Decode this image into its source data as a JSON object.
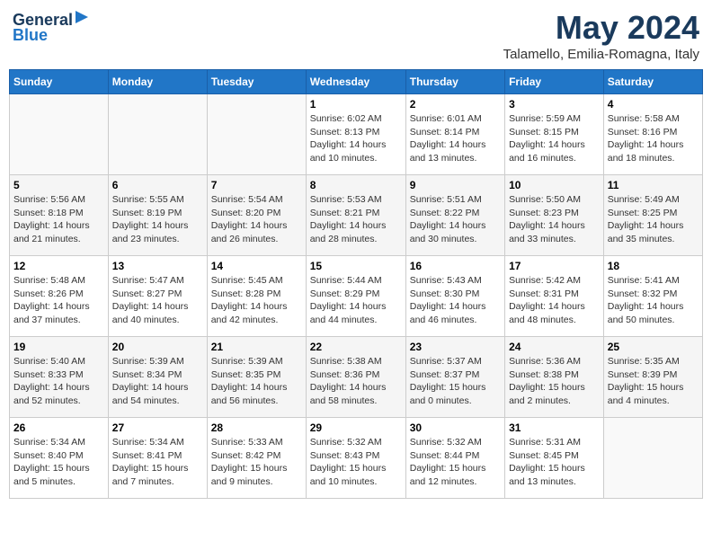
{
  "header": {
    "logo_line1": "General",
    "logo_line2": "Blue",
    "month": "May 2024",
    "location": "Talamello, Emilia-Romagna, Italy"
  },
  "weekdays": [
    "Sunday",
    "Monday",
    "Tuesday",
    "Wednesday",
    "Thursday",
    "Friday",
    "Saturday"
  ],
  "weeks": [
    [
      {
        "day": "",
        "info": ""
      },
      {
        "day": "",
        "info": ""
      },
      {
        "day": "",
        "info": ""
      },
      {
        "day": "1",
        "info": "Sunrise: 6:02 AM\nSunset: 8:13 PM\nDaylight: 14 hours\nand 10 minutes."
      },
      {
        "day": "2",
        "info": "Sunrise: 6:01 AM\nSunset: 8:14 PM\nDaylight: 14 hours\nand 13 minutes."
      },
      {
        "day": "3",
        "info": "Sunrise: 5:59 AM\nSunset: 8:15 PM\nDaylight: 14 hours\nand 16 minutes."
      },
      {
        "day": "4",
        "info": "Sunrise: 5:58 AM\nSunset: 8:16 PM\nDaylight: 14 hours\nand 18 minutes."
      }
    ],
    [
      {
        "day": "5",
        "info": "Sunrise: 5:56 AM\nSunset: 8:18 PM\nDaylight: 14 hours\nand 21 minutes."
      },
      {
        "day": "6",
        "info": "Sunrise: 5:55 AM\nSunset: 8:19 PM\nDaylight: 14 hours\nand 23 minutes."
      },
      {
        "day": "7",
        "info": "Sunrise: 5:54 AM\nSunset: 8:20 PM\nDaylight: 14 hours\nand 26 minutes."
      },
      {
        "day": "8",
        "info": "Sunrise: 5:53 AM\nSunset: 8:21 PM\nDaylight: 14 hours\nand 28 minutes."
      },
      {
        "day": "9",
        "info": "Sunrise: 5:51 AM\nSunset: 8:22 PM\nDaylight: 14 hours\nand 30 minutes."
      },
      {
        "day": "10",
        "info": "Sunrise: 5:50 AM\nSunset: 8:23 PM\nDaylight: 14 hours\nand 33 minutes."
      },
      {
        "day": "11",
        "info": "Sunrise: 5:49 AM\nSunset: 8:25 PM\nDaylight: 14 hours\nand 35 minutes."
      }
    ],
    [
      {
        "day": "12",
        "info": "Sunrise: 5:48 AM\nSunset: 8:26 PM\nDaylight: 14 hours\nand 37 minutes."
      },
      {
        "day": "13",
        "info": "Sunrise: 5:47 AM\nSunset: 8:27 PM\nDaylight: 14 hours\nand 40 minutes."
      },
      {
        "day": "14",
        "info": "Sunrise: 5:45 AM\nSunset: 8:28 PM\nDaylight: 14 hours\nand 42 minutes."
      },
      {
        "day": "15",
        "info": "Sunrise: 5:44 AM\nSunset: 8:29 PM\nDaylight: 14 hours\nand 44 minutes."
      },
      {
        "day": "16",
        "info": "Sunrise: 5:43 AM\nSunset: 8:30 PM\nDaylight: 14 hours\nand 46 minutes."
      },
      {
        "day": "17",
        "info": "Sunrise: 5:42 AM\nSunset: 8:31 PM\nDaylight: 14 hours\nand 48 minutes."
      },
      {
        "day": "18",
        "info": "Sunrise: 5:41 AM\nSunset: 8:32 PM\nDaylight: 14 hours\nand 50 minutes."
      }
    ],
    [
      {
        "day": "19",
        "info": "Sunrise: 5:40 AM\nSunset: 8:33 PM\nDaylight: 14 hours\nand 52 minutes."
      },
      {
        "day": "20",
        "info": "Sunrise: 5:39 AM\nSunset: 8:34 PM\nDaylight: 14 hours\nand 54 minutes."
      },
      {
        "day": "21",
        "info": "Sunrise: 5:39 AM\nSunset: 8:35 PM\nDaylight: 14 hours\nand 56 minutes."
      },
      {
        "day": "22",
        "info": "Sunrise: 5:38 AM\nSunset: 8:36 PM\nDaylight: 14 hours\nand 58 minutes."
      },
      {
        "day": "23",
        "info": "Sunrise: 5:37 AM\nSunset: 8:37 PM\nDaylight: 15 hours\nand 0 minutes."
      },
      {
        "day": "24",
        "info": "Sunrise: 5:36 AM\nSunset: 8:38 PM\nDaylight: 15 hours\nand 2 minutes."
      },
      {
        "day": "25",
        "info": "Sunrise: 5:35 AM\nSunset: 8:39 PM\nDaylight: 15 hours\nand 4 minutes."
      }
    ],
    [
      {
        "day": "26",
        "info": "Sunrise: 5:34 AM\nSunset: 8:40 PM\nDaylight: 15 hours\nand 5 minutes."
      },
      {
        "day": "27",
        "info": "Sunrise: 5:34 AM\nSunset: 8:41 PM\nDaylight: 15 hours\nand 7 minutes."
      },
      {
        "day": "28",
        "info": "Sunrise: 5:33 AM\nSunset: 8:42 PM\nDaylight: 15 hours\nand 9 minutes."
      },
      {
        "day": "29",
        "info": "Sunrise: 5:32 AM\nSunset: 8:43 PM\nDaylight: 15 hours\nand 10 minutes."
      },
      {
        "day": "30",
        "info": "Sunrise: 5:32 AM\nSunset: 8:44 PM\nDaylight: 15 hours\nand 12 minutes."
      },
      {
        "day": "31",
        "info": "Sunrise: 5:31 AM\nSunset: 8:45 PM\nDaylight: 15 hours\nand 13 minutes."
      },
      {
        "day": "",
        "info": ""
      }
    ]
  ]
}
